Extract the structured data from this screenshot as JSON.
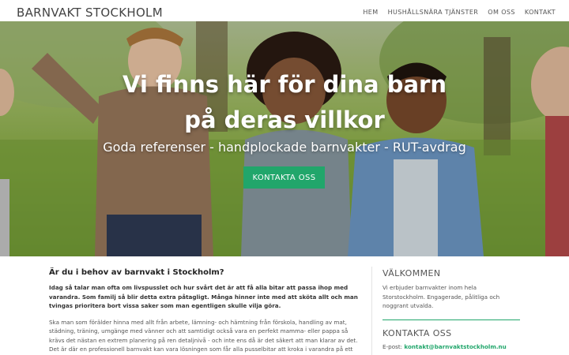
{
  "header": {
    "logo": "BARNVAKT STOCKHOLM",
    "nav": [
      "HEM",
      "HUSHÅLLSNÄRA TJÄNSTER",
      "OM OSS",
      "KONTAKT"
    ]
  },
  "hero": {
    "title_line1": "Vi finns här för dina barn",
    "title_line2": "på deras villkor",
    "subtitle": "Goda referenser - handplockade barnvakter - RUT-avdrag",
    "button": "KONTAKTA OSS"
  },
  "main": {
    "heading": "Är du i behov av barnvakt i Stockholm?",
    "lead": "Idag så talar man ofta om livspusslet och hur svårt det är att få alla bitar att passa ihop med varandra. Som familj så blir detta extra påtagligt. Många hinner inte med att sköta allt och man tvingas prioritera bort vissa saker som man egentligen skulle vilja göra.",
    "body": "Ska man som förälder hinna med allt från arbete, lämning- och hämtning från förskola, handling av mat, städning, träning, umgänge med vänner och att samtidigt också vara en perfekt mamma- eller pappa så krävs det nästan en extrem planering på ren detaljnivå - och inte ens då är det säkert att man klarar av det. Det är där en professionell barnvakt kan vara lösningen som får alla pusselbitar att kroka i varandra på ett"
  },
  "sidebar": {
    "welcome_heading": "VÄLKOMMEN",
    "welcome_text": "Vi erbjuder barnvakter inom hela Storstockholm. Engagerade, pålitliga och noggrant utvalda.",
    "contact_heading": "KONTAKTA OSS",
    "email_label": "E-post:",
    "email": "kontakt@barnvaktstockholm.nu"
  },
  "colors": {
    "accent": "#21a66b",
    "text": "#333333"
  }
}
